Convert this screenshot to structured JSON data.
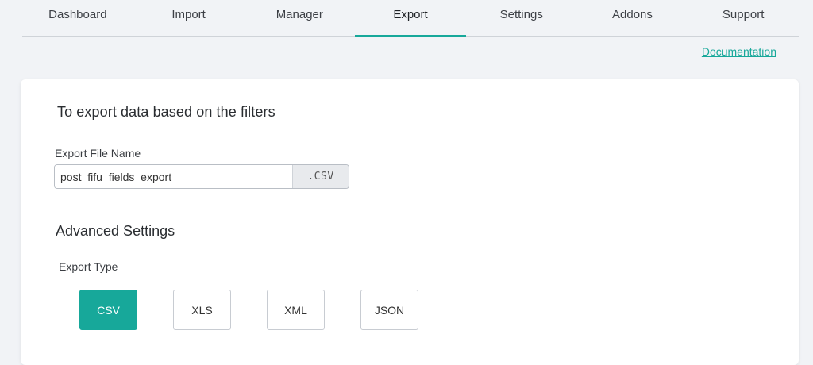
{
  "nav": {
    "tabs": [
      {
        "label": "Dashboard"
      },
      {
        "label": "Import"
      },
      {
        "label": "Manager"
      },
      {
        "label": "Export"
      },
      {
        "label": "Settings"
      },
      {
        "label": "Addons"
      },
      {
        "label": "Support"
      }
    ],
    "active": "Export"
  },
  "documentation_link": "Documentation",
  "export": {
    "heading": "To export data based on the filters",
    "file_name_label": "Export File Name",
    "file_name_value": "post_fifu_fields_export",
    "file_extension": ".CSV"
  },
  "advanced": {
    "title": "Advanced Settings",
    "export_type_label": "Export Type",
    "types": [
      {
        "label": "CSV"
      },
      {
        "label": "XLS"
      },
      {
        "label": "XML"
      },
      {
        "label": "JSON"
      }
    ],
    "selected_type": "CSV"
  },
  "colors": {
    "accent": "#17a89a",
    "background": "#f1f3f6",
    "card": "#ffffff"
  }
}
